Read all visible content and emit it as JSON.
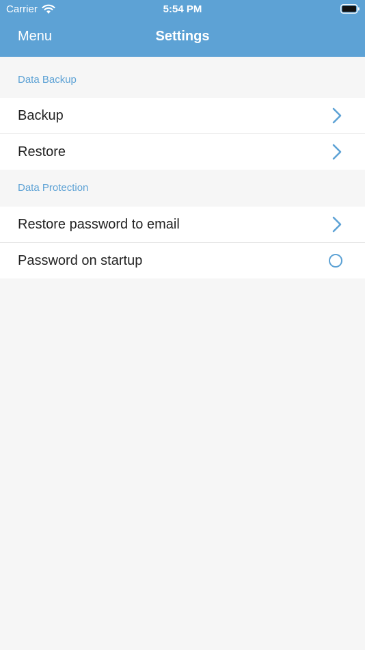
{
  "status_bar": {
    "carrier": "Carrier",
    "time": "5:54 PM"
  },
  "nav": {
    "menu_label": "Menu",
    "title": "Settings"
  },
  "sections": [
    {
      "title": "Data Backup",
      "rows": [
        {
          "label": "Backup",
          "accessory": "chevron-right-icon"
        },
        {
          "label": "Restore",
          "accessory": "chevron-right-icon"
        }
      ]
    },
    {
      "title": "Data Protection",
      "rows": [
        {
          "label": "Restore password to email",
          "accessory": "chevron-right-icon"
        },
        {
          "label": "Password on startup",
          "accessory": "radio-unchecked"
        }
      ]
    }
  ],
  "colors": {
    "accent": "#5da2d5",
    "background": "#f6f6f6",
    "row_background": "#ffffff",
    "text": "#222222"
  }
}
